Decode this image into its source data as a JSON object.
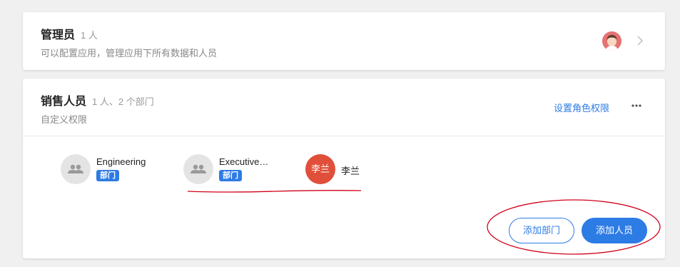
{
  "admin_role": {
    "title": "管理员",
    "count": "1 人",
    "description": "可以配置应用，管理应用下所有数据和人员"
  },
  "sales_role": {
    "title": "销售人员",
    "count": "1 人、2 个部门",
    "description": "自定义权限",
    "permission_link": "设置角色权限",
    "members": [
      {
        "name": "Engineering",
        "tag": "部门",
        "icon": "group-icon"
      },
      {
        "name": "Executive…",
        "tag": "部门",
        "icon": "group-icon"
      },
      {
        "name": "李兰",
        "avatar_text": "李兰",
        "avatar_color": "#e04f3a"
      }
    ],
    "add_department_label": "添加部门",
    "add_member_label": "添加人员"
  },
  "colors": {
    "accent": "#2d7be5",
    "annotation": "#d0021b"
  }
}
